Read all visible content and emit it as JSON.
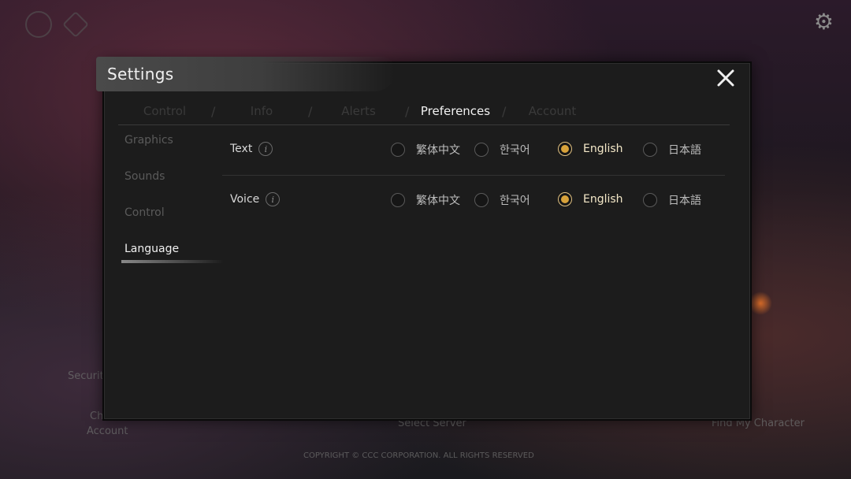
{
  "dialog": {
    "title": "Settings",
    "tabs": [
      {
        "label": "Control",
        "active": false
      },
      {
        "label": "Info",
        "active": false
      },
      {
        "label": "Alerts",
        "active": false
      },
      {
        "label": "Preferences",
        "active": true
      },
      {
        "label": "Account",
        "active": false
      }
    ],
    "sidebar": [
      {
        "label": "Graphics",
        "active": false
      },
      {
        "label": "Sounds",
        "active": false
      },
      {
        "label": "Control",
        "active": false
      },
      {
        "label": "Language",
        "active": true
      }
    ],
    "rows": [
      {
        "label": "Text",
        "options": [
          "繁体中文",
          "한국어",
          "English",
          "日本語"
        ],
        "selected": "English"
      },
      {
        "label": "Voice",
        "options": [
          "繁体中文",
          "한국어",
          "English",
          "日本語"
        ],
        "selected": "English"
      }
    ]
  },
  "background": {
    "security_label": "Securit",
    "change_account_label1": "Ch",
    "change_account_label2": "Account",
    "select_server": "Select Server",
    "find_character": "Find My Character",
    "copyright": "COPYRIGHT © CCC CORPORATION. ALL RIGHTS RESERVED"
  },
  "colors": {
    "accent": "#d8a23a",
    "dialog_bg": "#1c1c1c"
  }
}
